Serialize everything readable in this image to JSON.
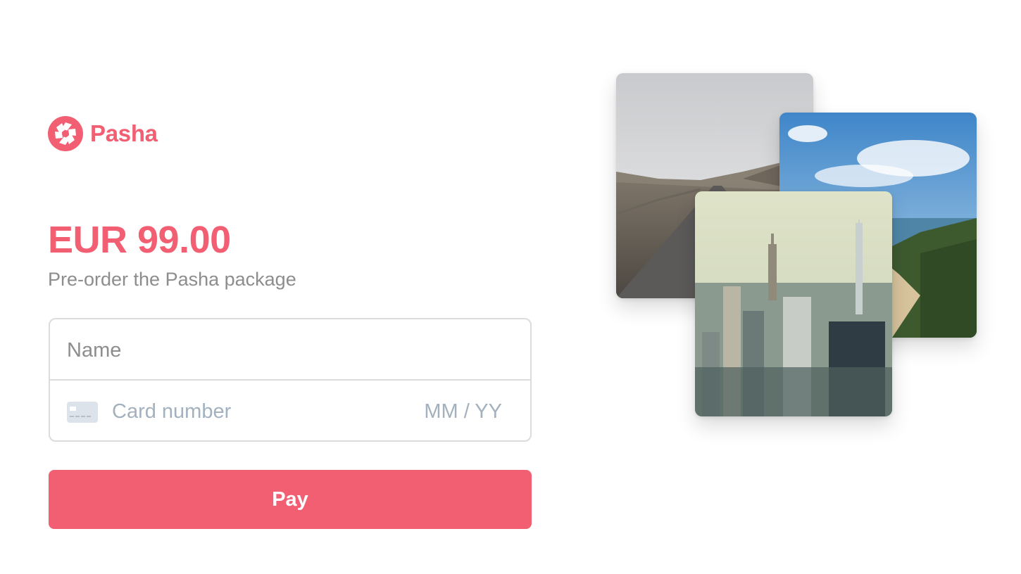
{
  "brand": {
    "name": "Pasha",
    "logo_icon": "aperture-icon",
    "color": "#f25f72"
  },
  "checkout": {
    "price": "EUR 99.00",
    "description": "Pre-order the Pasha package"
  },
  "form": {
    "name_placeholder": "Name",
    "card_placeholder": "Card number",
    "expiry_placeholder": "MM / YY",
    "card_icon": "credit-card-icon"
  },
  "actions": {
    "pay_label": "Pay",
    "pay_color": "#f25f72"
  },
  "gallery": {
    "images": [
      {
        "subject": "road-landscape"
      },
      {
        "subject": "coastline"
      },
      {
        "subject": "city-skyline"
      }
    ]
  }
}
